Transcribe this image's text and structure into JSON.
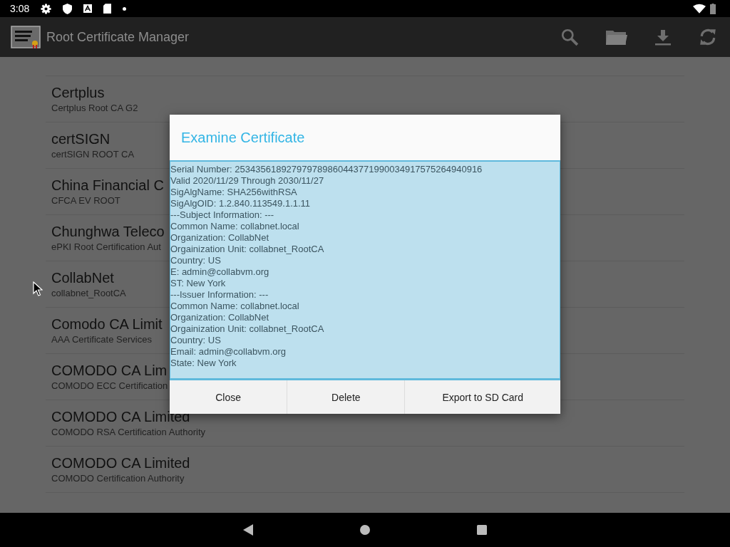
{
  "status_bar": {
    "time": "3:08"
  },
  "toolbar": {
    "title": "Root Certificate Manager"
  },
  "certificates": [
    {
      "name": "Certplus",
      "detail": "Certplus Root CA G2"
    },
    {
      "name": "certSIGN",
      "detail": "certSIGN ROOT CA"
    },
    {
      "name": "China Financial C",
      "detail": "CFCA EV ROOT"
    },
    {
      "name": "Chunghwa Teleco",
      "detail": "ePKI Root Certification Aut"
    },
    {
      "name": "CollabNet",
      "detail": "collabnet_RootCA"
    },
    {
      "name": "Comodo CA Limit",
      "detail": "AAA Certificate Services"
    },
    {
      "name": "COMODO CA Lim",
      "detail": "COMODO ECC Certification"
    },
    {
      "name": "COMODO CA Limited",
      "detail": "COMODO RSA Certification Authority"
    },
    {
      "name": "COMODO CA Limited",
      "detail": "COMODO Certification Authority"
    }
  ],
  "dialog": {
    "title": "Examine Certificate",
    "lines": [
      "Serial Number: 253435618927979789860443771990034917575264940916",
      "Valid 2020/11/29 Through 2030/11/27",
      "SigAlgName: SHA256withRSA",
      "SigAlgOID: 1.2.840.113549.1.1.11",
      "---Subject Information: ---",
      "Common Name: collabnet.local",
      "Organization: CollabNet",
      "Orgainization Unit: collabnet_RootCA",
      "Country: US",
      "E: admin@collabvm.org",
      "ST: New York",
      "---Issuer Information: ---",
      "Common Name: collabnet.local",
      "Organization: CollabNet",
      "Orgainization Unit: collabnet_RootCA",
      "Country: US",
      "Email: admin@collabvm.org",
      "State: New York"
    ],
    "buttons": [
      "Close",
      "Delete",
      "Export to SD Card"
    ]
  }
}
